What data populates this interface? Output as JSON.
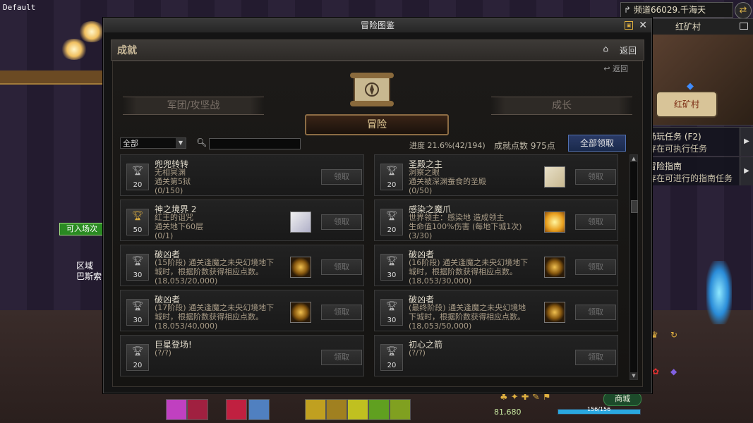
{
  "hud": {
    "default_label": "Default",
    "channel": "频道66029.千海天",
    "minimap_title": "红矿村",
    "minimap_tag": "红矿村",
    "quest1_title": "场玩任务 (F2)",
    "quest1_sub": "存在可执行任务",
    "quest2_title": "冒险指南",
    "quest2_sub": "存在可进行的指南任务",
    "enter_tag": "可入场次",
    "area_line1": "区域",
    "area_line2": "巴斯索",
    "gold": "81,680",
    "shop": "商城",
    "mp": "156/156"
  },
  "window": {
    "title": "冒险图鉴",
    "sub_title": "成就",
    "back": "返回",
    "back2": "返回",
    "tab_left": "军团/攻坚战",
    "tab_center": "冒险",
    "tab_right": "成长",
    "filter": "全部",
    "progress": "进度 21.6%(42/194)",
    "points": "成就点数 975点",
    "claim_all": "全部领取"
  },
  "cards": [
    {
      "name": "兜兜转转",
      "lines": [
        "无相冥渊",
        "通关第5狱",
        "(0/150)"
      ],
      "points": "20",
      "reward": "none",
      "claim": "领取"
    },
    {
      "name": "圣殿之主",
      "lines": [
        "洞察之眼",
        "通关被深渊蚕食的圣殿",
        "(0/50)"
      ],
      "points": "20",
      "reward": "map",
      "claim": "领取"
    },
    {
      "name": "神之境界 2",
      "lines": [
        "红王的诅咒",
        "通关地下60层",
        "(0/1)"
      ],
      "points": "50",
      "reward": "scroll",
      "claim": "领取"
    },
    {
      "name": "感染之魔爪",
      "lines": [
        "世界领主：感染地 造成领主",
        "生命值100%伤害 (每地下城1次)",
        "(3/30)"
      ],
      "points": "20",
      "reward": "burst",
      "claim": "领取"
    },
    {
      "name": "破凶者",
      "lines": [
        "(15阶段) 通关逢魔之未央幻境地下",
        "城时，根据阶数获得相应点数。",
        "(18,053/20,000)"
      ],
      "points": "30",
      "reward": "emblem",
      "claim": "领取"
    },
    {
      "name": "破凶者",
      "lines": [
        "(16阶段) 通关逢魔之未央幻境地下",
        "城时，根据阶数获得相应点数。",
        "(18,053/30,000)"
      ],
      "points": "30",
      "reward": "emblem",
      "claim": "领取"
    },
    {
      "name": "破凶者",
      "lines": [
        "(17阶段) 通关逢魔之未央幻境地下",
        "城时，根据阶数获得相应点数。",
        "(18,053/40,000)"
      ],
      "points": "30",
      "reward": "emblem",
      "claim": "领取"
    },
    {
      "name": "破凶者",
      "lines": [
        "(最终阶段) 通关逢魔之未央幻境地",
        "下城时，根据阶数获得相应点数。",
        "(18,053/50,000)"
      ],
      "points": "30",
      "reward": "emblem",
      "claim": "领取"
    },
    {
      "name": "巨星登场!",
      "lines": [
        "(?/?)"
      ],
      "points": "20",
      "reward": "none",
      "claim": "领取"
    },
    {
      "name": "初心之箭",
      "lines": [
        "(?/?)"
      ],
      "points": "20",
      "reward": "none",
      "claim": "领取"
    }
  ],
  "colors": {
    "panel_bg": "#141414",
    "accent_gold": "#e0b040",
    "claim_all_blue": "#2a3a66"
  }
}
